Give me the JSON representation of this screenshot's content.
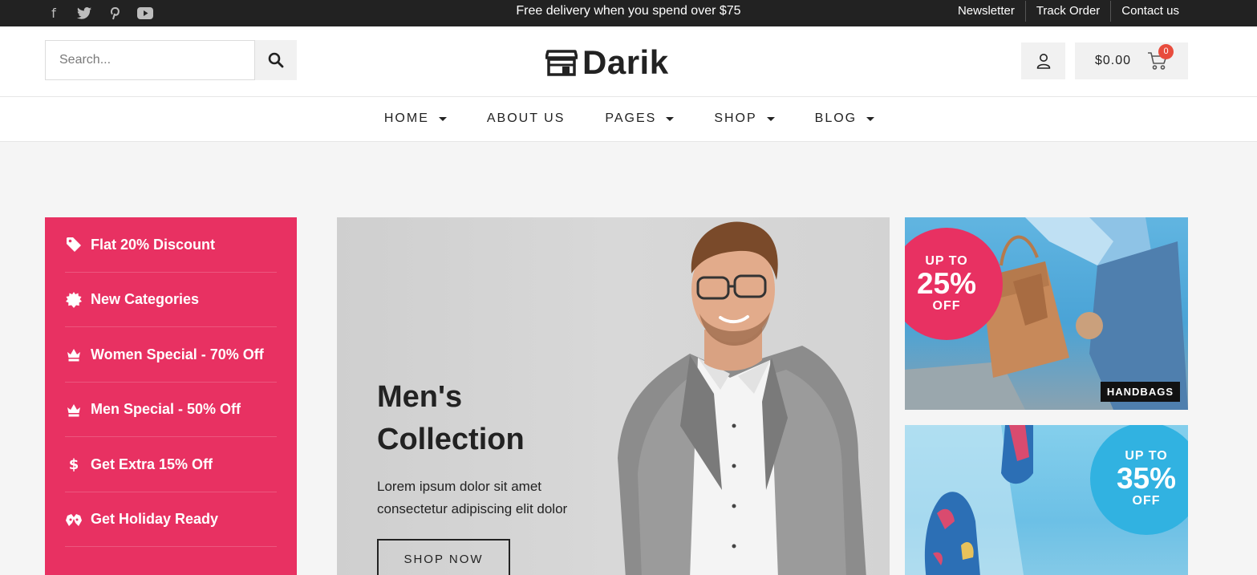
{
  "topbar": {
    "social_icons": [
      "facebook-icon",
      "twitter-icon",
      "pinterest-icon",
      "youtube-icon"
    ],
    "promo": "Free delivery when you spend over $75",
    "links": [
      "Newsletter",
      "Track Order",
      "Contact us"
    ]
  },
  "header": {
    "search": {
      "placeholder": "Search..."
    },
    "logo_text": "Darik",
    "cart": {
      "total": "$0.00",
      "count": "0"
    }
  },
  "nav": {
    "items": [
      {
        "label": "HOME",
        "has_dropdown": true
      },
      {
        "label": "ABOUT US",
        "has_dropdown": false
      },
      {
        "label": "PAGES",
        "has_dropdown": true
      },
      {
        "label": "SHOP",
        "has_dropdown": true
      },
      {
        "label": "BLOG",
        "has_dropdown": true
      }
    ]
  },
  "sidebar": {
    "items": [
      {
        "label": "Flat 20% Discount",
        "icon": "tag-icon"
      },
      {
        "label": "New Categories",
        "icon": "badge-icon"
      },
      {
        "label": "Women Special - 70% Off",
        "icon": "crown-icon"
      },
      {
        "label": "Men Special - 50% Off",
        "icon": "crown-icon"
      },
      {
        "label": "Get Extra 15% Off",
        "icon": "dollar-icon"
      },
      {
        "label": "Get Holiday Ready",
        "icon": "gift-icon"
      }
    ]
  },
  "hero": {
    "title_line1": "Men's",
    "title_line2": "Collection",
    "desc_line1": "Lorem ipsum dolor sit amet",
    "desc_line2": "consectetur adipiscing elit dolor",
    "button": "SHOP NOW"
  },
  "banners": [
    {
      "upto": "UP TO",
      "percent": "25%",
      "off": "OFF",
      "tag": "HANDBAGS",
      "color": "#e83162"
    },
    {
      "upto": "UP TO",
      "percent": "35%",
      "off": "OFF",
      "color": "#31b2e1"
    }
  ],
  "colors": {
    "accent": "#e83162",
    "topbar": "#222222",
    "badge": "#e84c3d"
  }
}
